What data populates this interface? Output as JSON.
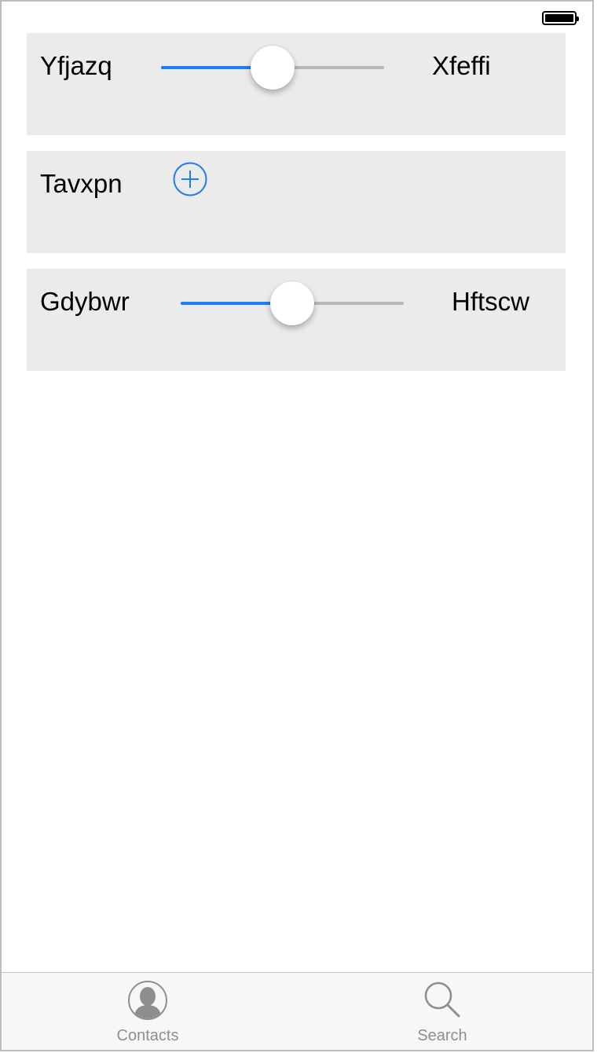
{
  "status_bar": {
    "battery_level": 1.0
  },
  "rows": [
    {
      "type": "slider",
      "left_label": "Yfjazq",
      "right_label": "Xfeffi",
      "value": 0.5
    },
    {
      "type": "add",
      "label": "Tavxpn",
      "icon": "plus-circle-icon"
    },
    {
      "type": "slider",
      "left_label": "Gdybwr",
      "right_label": "Hftscw",
      "value": 0.5
    }
  ],
  "tab_bar": {
    "items": [
      {
        "label": "Contacts",
        "icon": "contact-person-icon"
      },
      {
        "label": "Search",
        "icon": "magnifier-icon"
      }
    ]
  },
  "colors": {
    "accent": "#1b7ef2",
    "card_background": "#ebebeb",
    "track_inactive": "#b7b7b7",
    "tab_text": "#8e8e8e"
  }
}
